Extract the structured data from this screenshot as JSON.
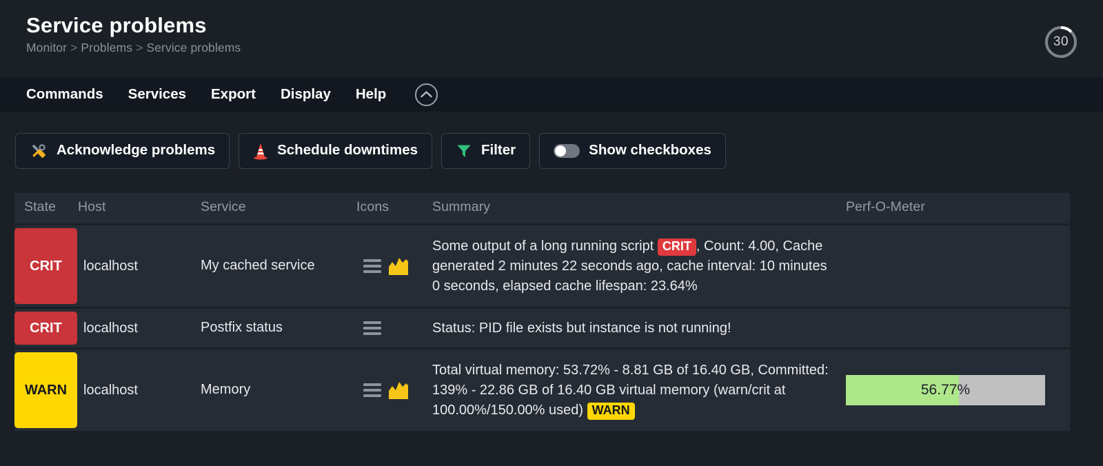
{
  "header": {
    "title": "Service problems",
    "breadcrumb": [
      "Monitor",
      "Problems",
      "Service problems"
    ],
    "breadcrumb_separator": ">",
    "refresh_counter": "30"
  },
  "menubar": {
    "items": [
      {
        "label": "Commands",
        "name": "menu-commands"
      },
      {
        "label": "Services",
        "name": "menu-services"
      },
      {
        "label": "Export",
        "name": "menu-export"
      },
      {
        "label": "Display",
        "name": "menu-display"
      },
      {
        "label": "Help",
        "name": "menu-help"
      }
    ],
    "collapse_icon": "chevron-up-icon"
  },
  "toolbar": {
    "buttons": [
      {
        "label": "Acknowledge problems",
        "icon": "hammer-wrench-icon"
      },
      {
        "label": "Schedule downtimes",
        "icon": "traffic-cone-icon"
      },
      {
        "label": "Filter",
        "icon": "funnel-icon"
      },
      {
        "label": "Show checkboxes",
        "icon": "toggle-switch-off-icon",
        "toggle_state": "off"
      }
    ]
  },
  "table": {
    "columns": [
      "State",
      "Host",
      "Service",
      "Icons",
      "Summary",
      "Perf-O-Meter"
    ],
    "rows": [
      {
        "state": "CRIT",
        "state_kind": "crit",
        "host": "localhost",
        "service": "My cached service",
        "icons": [
          "hamburger-icon",
          "graph-icon"
        ],
        "summary_parts": [
          {
            "type": "text",
            "text": "Some output of a long running script "
          },
          {
            "type": "badge",
            "text": "CRIT",
            "kind": "crit"
          },
          {
            "type": "text",
            "text": ", Count: 4.00, Cache generated 2 minutes 22 seconds ago, cache interval: 10 minutes 0 seconds, elapsed cache lifespan: 23.64%"
          }
        ],
        "perf": null
      },
      {
        "state": "CRIT",
        "state_kind": "crit",
        "host": "localhost",
        "service": "Postfix status",
        "icons": [
          "hamburger-icon"
        ],
        "summary_parts": [
          {
            "type": "text",
            "text": "Status: PID file exists but instance is not running!"
          }
        ],
        "perf": null
      },
      {
        "state": "WARN",
        "state_kind": "warn",
        "host": "localhost",
        "service": "Memory",
        "icons": [
          "hamburger-icon",
          "graph-icon"
        ],
        "summary_parts": [
          {
            "type": "text",
            "text": "Total virtual memory: 53.72% - 8.81 GB of 16.40 GB, Committed: 139% - 22.86 GB of 16.40 GB virtual memory (warn/crit at 100.00%/150.00% used) "
          },
          {
            "type": "badge",
            "text": "WARN",
            "kind": "warn"
          }
        ],
        "perf": {
          "label": "56.77%",
          "percent": 56.77
        }
      }
    ]
  },
  "colors": {
    "page_background": "#1b2026",
    "menubar_background": "#131820",
    "row_background": "#262c35",
    "header_row_background": "#252b34",
    "crit_red": "#c9353a",
    "warn_yellow": "#ffd703",
    "perf_green": "#aee68a",
    "perf_track": "#c0c0c0",
    "filter_green": "#32bf7e"
  }
}
